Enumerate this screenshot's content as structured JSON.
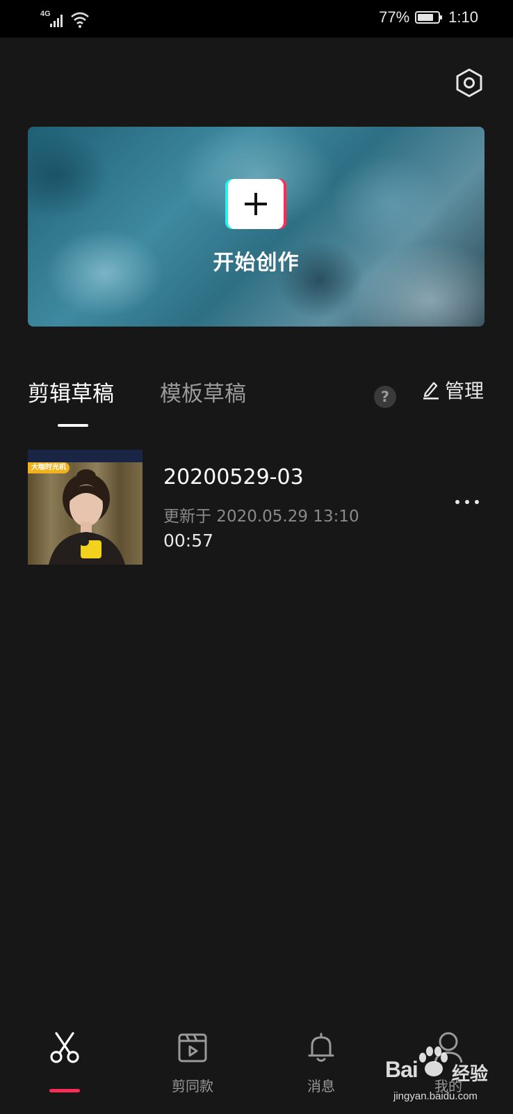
{
  "status_bar": {
    "network": "4G",
    "battery_percent": "77%",
    "time": "1:10"
  },
  "header": {
    "settings_icon": "hexagon-settings-icon"
  },
  "banner": {
    "create_label": "开始创作",
    "plus_icon": "plus-icon"
  },
  "tabs": {
    "items": [
      {
        "label": "剪辑草稿",
        "active": true
      },
      {
        "label": "模板草稿",
        "active": false
      }
    ],
    "help_label": "?",
    "manage_label": "管理"
  },
  "drafts": [
    {
      "thumbnail_tag": "大咖时光机",
      "name": "20200529-03",
      "updated": "更新于 2020.05.29 13:10",
      "duration": "00:57"
    }
  ],
  "bottom_nav": {
    "items": [
      {
        "label": "",
        "icon": "scissors-icon",
        "active": true
      },
      {
        "label": "剪同款",
        "icon": "clapperboard-icon",
        "active": false
      },
      {
        "label": "消息",
        "icon": "bell-icon",
        "active": false
      },
      {
        "label": "我的",
        "icon": "person-icon",
        "active": false
      }
    ]
  },
  "watermark": {
    "brand_text": "Bai",
    "brand_text_tail": "经验",
    "url": "jingyan.baidu.com"
  },
  "colors": {
    "background": "#171717",
    "accent": "#fe2c55",
    "accent_cyan": "#25f4ee",
    "muted_text": "#9a9a9a"
  }
}
